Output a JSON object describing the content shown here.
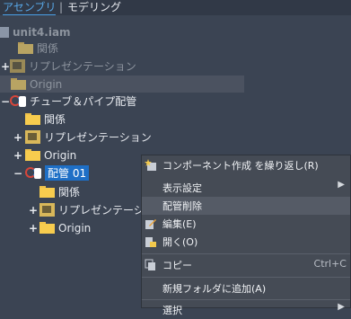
{
  "tabs": {
    "active": "アセンブリ",
    "separator": "|",
    "inactive": "モデリング"
  },
  "tree": {
    "root": "unit4.iam",
    "root_children": [
      "関係",
      "リプレゼンテーション",
      "Origin"
    ],
    "tube": "チューブ＆パイプ配管",
    "tube_children": [
      "関係",
      "リプレゼンテーション",
      "Origin"
    ],
    "run": "配管 01",
    "run_children": [
      "関係",
      "リプレゼンテーション",
      "Origin"
    ],
    "expanders": {
      "plus": "+",
      "minus": "−"
    }
  },
  "menu": {
    "items": [
      {
        "label": "コンポーネント作成 を繰り返し(R)",
        "icon": "star-component-icon"
      },
      {
        "label": "表示設定",
        "submenu": "▶"
      },
      {
        "label": "配管削除"
      },
      {
        "label": "編集(E)",
        "icon": "edit-icon"
      },
      {
        "label": "開く(O)",
        "icon": "open-icon"
      },
      {
        "label": "コピー",
        "shortcut": "Ctrl+C",
        "icon": "copy-icon"
      },
      {
        "label": "新規フォルダに追加(A)"
      },
      {
        "label": "選択",
        "submenu": "▶"
      }
    ]
  },
  "colors": {
    "selection": "#1e6fc6",
    "tab_accent": "#4aa0e8",
    "folder": "#f7cc4e"
  }
}
